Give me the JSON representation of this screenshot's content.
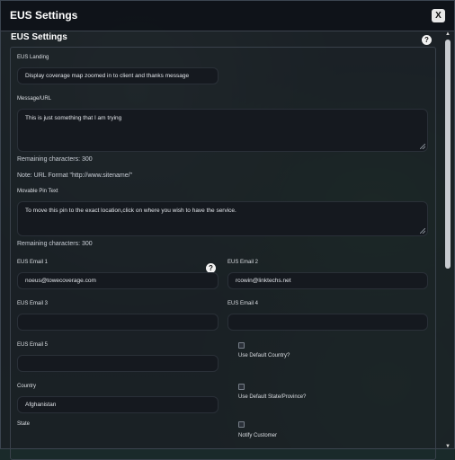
{
  "window": {
    "title": "EUS Settings",
    "close_label": "X"
  },
  "section": {
    "title": "EUS Settings"
  },
  "landing": {
    "label": "EUS Landing",
    "value": "Display coverage map zoomed in to client and thanks message"
  },
  "message": {
    "label": "Message/URL",
    "value": "This is just something that I am trying",
    "remaining": "Remaining characters: 300",
    "note": "Note: URL Format \"http://www.sitename/\""
  },
  "pin": {
    "label": "Movable Pin Text",
    "value": "To move this pin to the exact location,click on where you wish to have the service.",
    "remaining": "Remaining characters: 300"
  },
  "emails": {
    "email1_label": "EUS Email 1",
    "email1_value": "noeus@towecoverage.com",
    "email2_label": "EUS Email 2",
    "email2_value": "rcowin@linktechs.net",
    "email3_label": "EUS Email 3",
    "email3_value": "",
    "email4_label": "EUS Email 4",
    "email4_value": "",
    "email5_label": "EUS Email 5",
    "email5_value": ""
  },
  "options": {
    "default_country_label": "Use Default Country?",
    "default_state_label": "Use Default State/Province?",
    "notify_customer_label": "Notify Customer"
  },
  "location": {
    "country_label": "Country",
    "country_value": "Afghanistan",
    "state_label": "State"
  },
  "help": {
    "glyph": "?"
  },
  "icons": [
    "close-icon",
    "help-icon",
    "resize-grip-icon",
    "scroll-up-icon",
    "scroll-down-icon"
  ]
}
